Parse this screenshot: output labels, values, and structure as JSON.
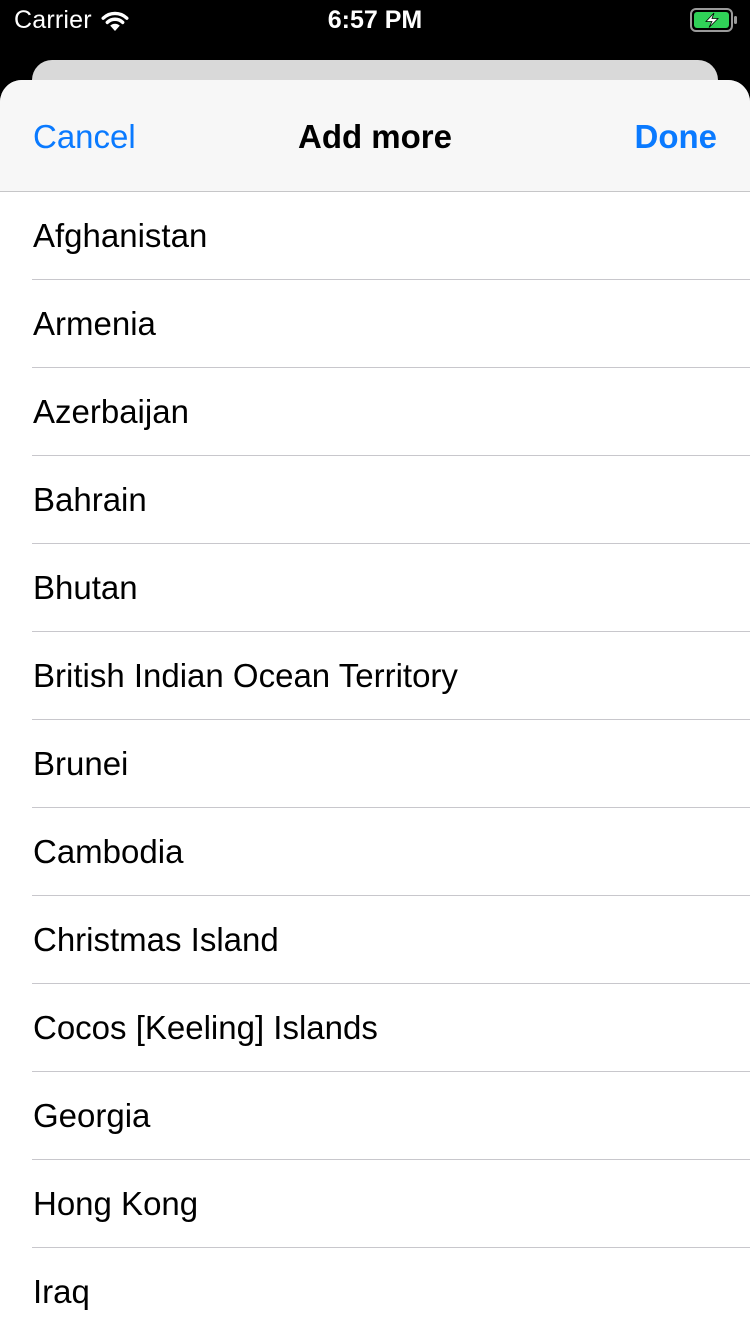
{
  "status_bar": {
    "carrier": "Carrier",
    "time": "6:57 PM",
    "wifi_icon": "wifi-icon",
    "battery_icon": "battery-charging-icon",
    "battery_color": "#30d158"
  },
  "nav": {
    "cancel_label": "Cancel",
    "title": "Add more",
    "done_label": "Done",
    "accent_color": "#0a7aff"
  },
  "countries": [
    "Afghanistan",
    "Armenia",
    "Azerbaijan",
    "Bahrain",
    "Bhutan",
    "British Indian Ocean Territory",
    "Brunei",
    "Cambodia",
    "Christmas Island",
    "Cocos [Keeling] Islands",
    "Georgia",
    "Hong Kong",
    "Iraq"
  ]
}
